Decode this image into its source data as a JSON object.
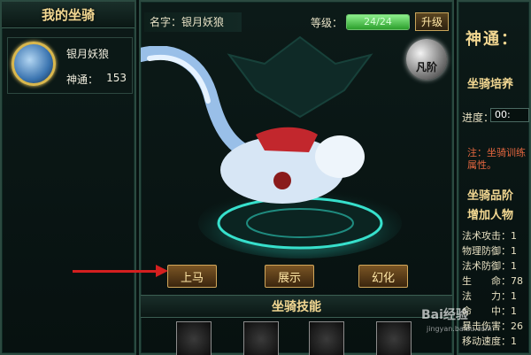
{
  "left_panel": {
    "title": "我的坐骑",
    "mount": {
      "name": "银月妖狼",
      "stat_label": "神通：",
      "stat_value": "153"
    }
  },
  "center_panel": {
    "name_label": "名字：银月妖狼",
    "level_label": "等级：",
    "level_text": "24/24",
    "level_progress": 1.0,
    "upgrade_label": "升级",
    "rank_label": "凡阶",
    "buttons": {
      "mount": "上马",
      "show": "展示",
      "transform": "幻化"
    },
    "skills_title": "坐骑技能"
  },
  "right_panel": {
    "title": "神通：",
    "section_train": "坐骑培养",
    "progress_label": "进度：",
    "progress_value": "00:",
    "note": "注：坐骑训练",
    "note2": "属性。",
    "section_rank": "坐骑品阶",
    "section_add": "增加人物",
    "stats": [
      {
        "label": "法术攻击：",
        "value": "1"
      },
      {
        "label": "物理防御：",
        "value": "1"
      },
      {
        "label": "法术防御：",
        "value": "1"
      },
      {
        "label": "生　　命：",
        "value": "78"
      },
      {
        "label": "法　　力：",
        "value": "1"
      },
      {
        "label": "命　　中：",
        "value": "1"
      },
      {
        "label": "暴击伤害：",
        "value": "26"
      },
      {
        "label": "移动速度：",
        "value": "1"
      }
    ]
  },
  "watermark": {
    "text": "Bai经验",
    "sub": "jingyan.baidu.com"
  },
  "colors": {
    "gold": "#f3d892",
    "bar_green": "#6bbf6b",
    "arrow_red": "#d41f1f"
  }
}
